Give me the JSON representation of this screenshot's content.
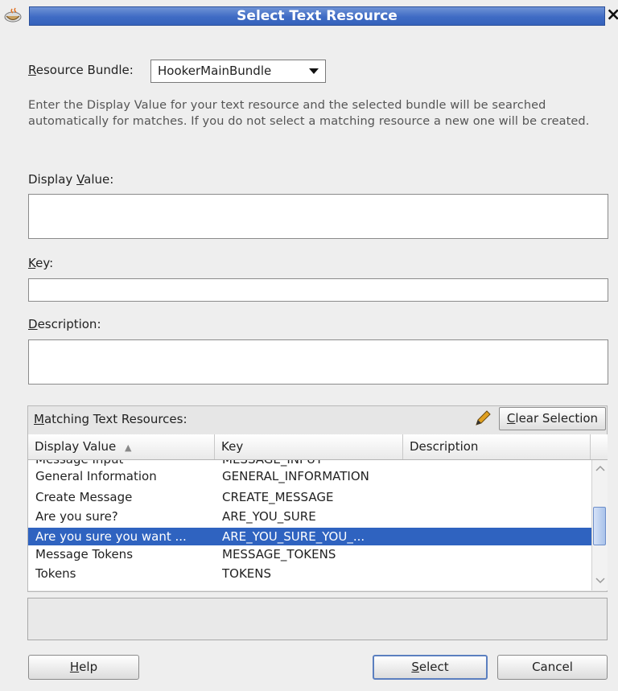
{
  "window": {
    "title": "Select Text Resource",
    "close_glyph": "×"
  },
  "form": {
    "bundle_label_u": "R",
    "bundle_label_rest": "esource Bundle:",
    "bundle_value": "HookerMainBundle",
    "help_text": "Enter the Display Value for your text resource and the selected bundle will be searched automatically for matches.  If you do not select a matching resource a new one will be created.",
    "display_label_pre": "Display ",
    "display_label_u": "V",
    "display_label_post": "alue:",
    "display_value": "",
    "key_label_u": "K",
    "key_label_rest": "ey:",
    "key_value": "",
    "desc_label_u": "D",
    "desc_label_rest": "escription:",
    "desc_value": ""
  },
  "matching": {
    "label_u": "M",
    "label_rest": "atching Text Resources:",
    "clear_u": "C",
    "clear_rest": "lear Selection",
    "columns": [
      "Display Value",
      "Key",
      "Description"
    ],
    "sort_glyph": "▲",
    "partial_row": {
      "display": "Message Input",
      "key": "MESSAGE_INPUT"
    },
    "rows": [
      {
        "display": "General Information",
        "key": "GENERAL_INFORMATION",
        "description": ""
      },
      {
        "display": "Create Message",
        "key": "CREATE_MESSAGE",
        "description": ""
      },
      {
        "display": "Are you sure?",
        "key": "ARE_YOU_SURE",
        "description": ""
      },
      {
        "display": "Are you sure you want ...",
        "key": "ARE_YOU_SURE_YOU_...",
        "description": "",
        "selected": true
      },
      {
        "display": "Message Tokens",
        "key": "MESSAGE_TOKENS",
        "description": ""
      },
      {
        "display": "Tokens",
        "key": "TOKENS",
        "description": ""
      }
    ]
  },
  "buttons": {
    "help_u": "H",
    "help_rest": "elp",
    "select_u": "S",
    "select_rest": "elect",
    "cancel": "Cancel"
  },
  "colors": {
    "title_bar": "#3f6bc4",
    "selection": "#2f63c0"
  }
}
